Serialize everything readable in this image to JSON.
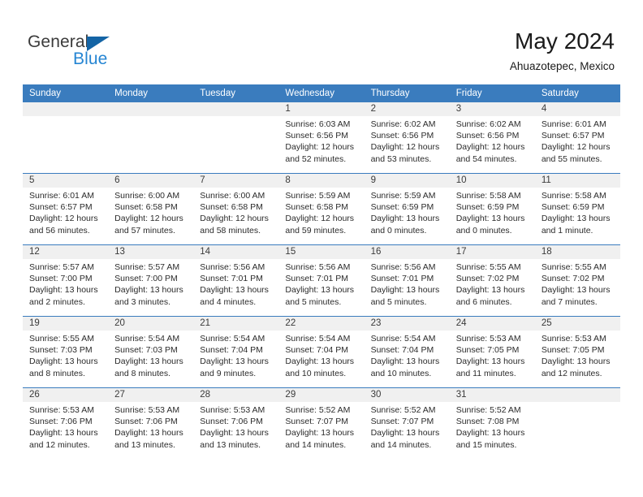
{
  "brand": {
    "name_dark": "General",
    "name_light": "Blue",
    "accent_color": "#2585d3",
    "triangle_color": "#1464a5"
  },
  "header": {
    "title": "May 2024",
    "subtitle": "Ahuazotepec, Mexico"
  },
  "calendar": {
    "header_bg": "#3a7cbe",
    "number_band_bg": "#f0f0f0",
    "weekdays": [
      "Sunday",
      "Monday",
      "Tuesday",
      "Wednesday",
      "Thursday",
      "Friday",
      "Saturday"
    ],
    "weeks": [
      [
        {
          "day": "",
          "lines": []
        },
        {
          "day": "",
          "lines": []
        },
        {
          "day": "",
          "lines": []
        },
        {
          "day": "1",
          "lines": [
            "Sunrise: 6:03 AM",
            "Sunset: 6:56 PM",
            "Daylight: 12 hours",
            "and 52 minutes."
          ]
        },
        {
          "day": "2",
          "lines": [
            "Sunrise: 6:02 AM",
            "Sunset: 6:56 PM",
            "Daylight: 12 hours",
            "and 53 minutes."
          ]
        },
        {
          "day": "3",
          "lines": [
            "Sunrise: 6:02 AM",
            "Sunset: 6:56 PM",
            "Daylight: 12 hours",
            "and 54 minutes."
          ]
        },
        {
          "day": "4",
          "lines": [
            "Sunrise: 6:01 AM",
            "Sunset: 6:57 PM",
            "Daylight: 12 hours",
            "and 55 minutes."
          ]
        }
      ],
      [
        {
          "day": "5",
          "lines": [
            "Sunrise: 6:01 AM",
            "Sunset: 6:57 PM",
            "Daylight: 12 hours",
            "and 56 minutes."
          ]
        },
        {
          "day": "6",
          "lines": [
            "Sunrise: 6:00 AM",
            "Sunset: 6:58 PM",
            "Daylight: 12 hours",
            "and 57 minutes."
          ]
        },
        {
          "day": "7",
          "lines": [
            "Sunrise: 6:00 AM",
            "Sunset: 6:58 PM",
            "Daylight: 12 hours",
            "and 58 minutes."
          ]
        },
        {
          "day": "8",
          "lines": [
            "Sunrise: 5:59 AM",
            "Sunset: 6:58 PM",
            "Daylight: 12 hours",
            "and 59 minutes."
          ]
        },
        {
          "day": "9",
          "lines": [
            "Sunrise: 5:59 AM",
            "Sunset: 6:59 PM",
            "Daylight: 13 hours",
            "and 0 minutes."
          ]
        },
        {
          "day": "10",
          "lines": [
            "Sunrise: 5:58 AM",
            "Sunset: 6:59 PM",
            "Daylight: 13 hours",
            "and 0 minutes."
          ]
        },
        {
          "day": "11",
          "lines": [
            "Sunrise: 5:58 AM",
            "Sunset: 6:59 PM",
            "Daylight: 13 hours",
            "and 1 minute."
          ]
        }
      ],
      [
        {
          "day": "12",
          "lines": [
            "Sunrise: 5:57 AM",
            "Sunset: 7:00 PM",
            "Daylight: 13 hours",
            "and 2 minutes."
          ]
        },
        {
          "day": "13",
          "lines": [
            "Sunrise: 5:57 AM",
            "Sunset: 7:00 PM",
            "Daylight: 13 hours",
            "and 3 minutes."
          ]
        },
        {
          "day": "14",
          "lines": [
            "Sunrise: 5:56 AM",
            "Sunset: 7:01 PM",
            "Daylight: 13 hours",
            "and 4 minutes."
          ]
        },
        {
          "day": "15",
          "lines": [
            "Sunrise: 5:56 AM",
            "Sunset: 7:01 PM",
            "Daylight: 13 hours",
            "and 5 minutes."
          ]
        },
        {
          "day": "16",
          "lines": [
            "Sunrise: 5:56 AM",
            "Sunset: 7:01 PM",
            "Daylight: 13 hours",
            "and 5 minutes."
          ]
        },
        {
          "day": "17",
          "lines": [
            "Sunrise: 5:55 AM",
            "Sunset: 7:02 PM",
            "Daylight: 13 hours",
            "and 6 minutes."
          ]
        },
        {
          "day": "18",
          "lines": [
            "Sunrise: 5:55 AM",
            "Sunset: 7:02 PM",
            "Daylight: 13 hours",
            "and 7 minutes."
          ]
        }
      ],
      [
        {
          "day": "19",
          "lines": [
            "Sunrise: 5:55 AM",
            "Sunset: 7:03 PM",
            "Daylight: 13 hours",
            "and 8 minutes."
          ]
        },
        {
          "day": "20",
          "lines": [
            "Sunrise: 5:54 AM",
            "Sunset: 7:03 PM",
            "Daylight: 13 hours",
            "and 8 minutes."
          ]
        },
        {
          "day": "21",
          "lines": [
            "Sunrise: 5:54 AM",
            "Sunset: 7:04 PM",
            "Daylight: 13 hours",
            "and 9 minutes."
          ]
        },
        {
          "day": "22",
          "lines": [
            "Sunrise: 5:54 AM",
            "Sunset: 7:04 PM",
            "Daylight: 13 hours",
            "and 10 minutes."
          ]
        },
        {
          "day": "23",
          "lines": [
            "Sunrise: 5:54 AM",
            "Sunset: 7:04 PM",
            "Daylight: 13 hours",
            "and 10 minutes."
          ]
        },
        {
          "day": "24",
          "lines": [
            "Sunrise: 5:53 AM",
            "Sunset: 7:05 PM",
            "Daylight: 13 hours",
            "and 11 minutes."
          ]
        },
        {
          "day": "25",
          "lines": [
            "Sunrise: 5:53 AM",
            "Sunset: 7:05 PM",
            "Daylight: 13 hours",
            "and 12 minutes."
          ]
        }
      ],
      [
        {
          "day": "26",
          "lines": [
            "Sunrise: 5:53 AM",
            "Sunset: 7:06 PM",
            "Daylight: 13 hours",
            "and 12 minutes."
          ]
        },
        {
          "day": "27",
          "lines": [
            "Sunrise: 5:53 AM",
            "Sunset: 7:06 PM",
            "Daylight: 13 hours",
            "and 13 minutes."
          ]
        },
        {
          "day": "28",
          "lines": [
            "Sunrise: 5:53 AM",
            "Sunset: 7:06 PM",
            "Daylight: 13 hours",
            "and 13 minutes."
          ]
        },
        {
          "day": "29",
          "lines": [
            "Sunrise: 5:52 AM",
            "Sunset: 7:07 PM",
            "Daylight: 13 hours",
            "and 14 minutes."
          ]
        },
        {
          "day": "30",
          "lines": [
            "Sunrise: 5:52 AM",
            "Sunset: 7:07 PM",
            "Daylight: 13 hours",
            "and 14 minutes."
          ]
        },
        {
          "day": "31",
          "lines": [
            "Sunrise: 5:52 AM",
            "Sunset: 7:08 PM",
            "Daylight: 13 hours",
            "and 15 minutes."
          ]
        },
        {
          "day": "",
          "lines": []
        }
      ]
    ]
  }
}
